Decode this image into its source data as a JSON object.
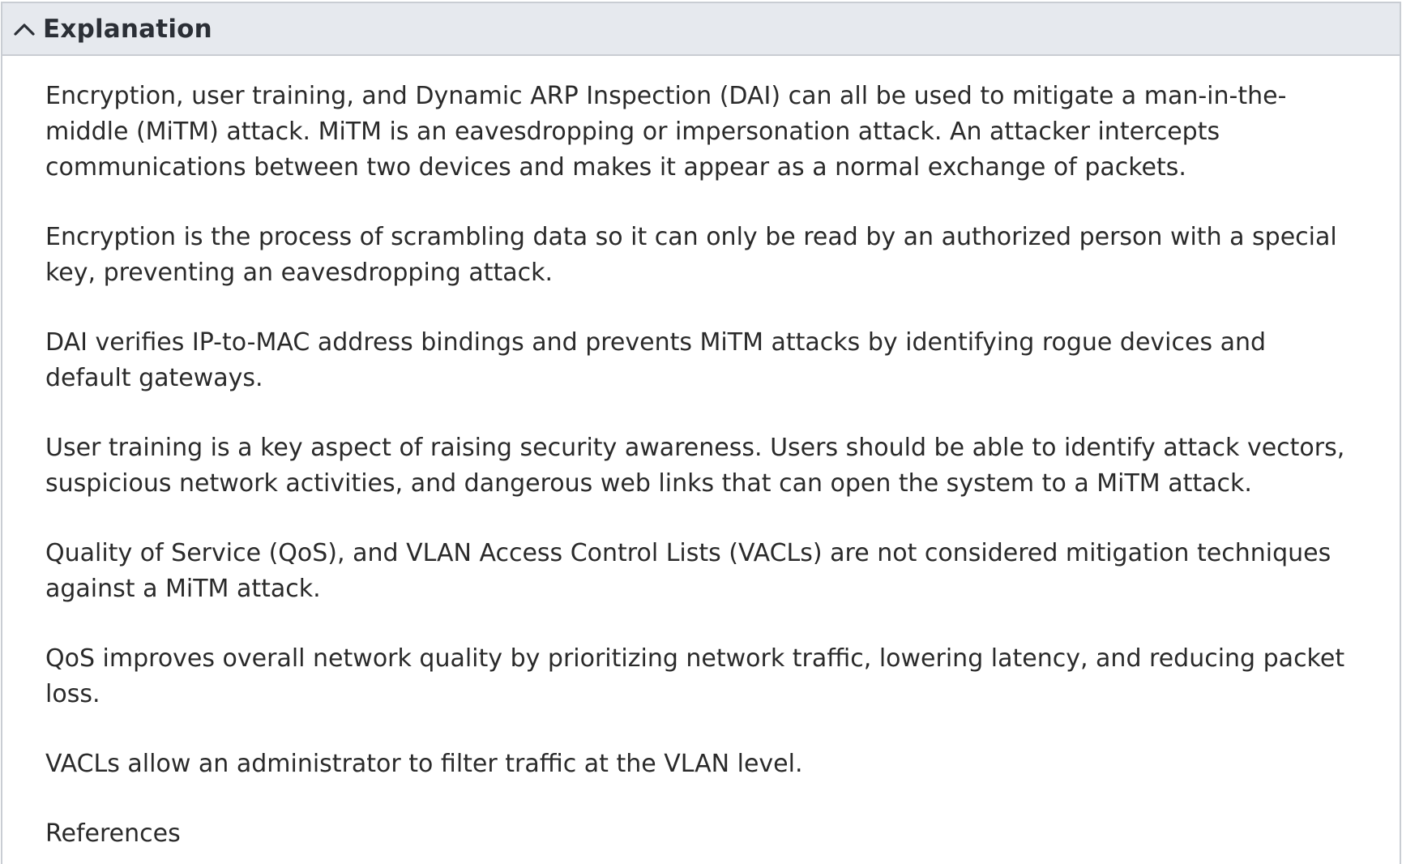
{
  "header": {
    "title": "Explanation",
    "toggle_icon": "chevron-up-icon"
  },
  "explanation": {
    "paragraphs": [
      "Encryption, user training, and Dynamic ARP Inspection (DAI) can all be used to mitigate a man-in-the-middle (MiTM) attack. MiTM is an eavesdropping or impersonation attack. An attacker intercepts communications between two devices and makes it appear as a normal exchange of packets.",
      "Encryption is the process of scrambling data so it can only be read by an authorized person with a special key, preventing an eavesdropping attack.",
      "DAI verifies IP-to-MAC address bindings and prevents MiTM attacks by identifying rogue devices and default gateways.",
      "User training is a key aspect of raising security awareness. Users should be able to identify attack vectors, suspicious network activities, and dangerous web links that can open the system to a MiTM attack.",
      "Quality of Service (QoS), and VLAN Access Control Lists (VACLs) are not considered mitigation techniques against a MiTM attack.",
      "QoS improves overall network quality by prioritizing network traffic, lowering latency, and reducing packet loss.",
      "VACLs allow an administrator to filter traffic at the VLAN level."
    ],
    "references_label": "References"
  }
}
